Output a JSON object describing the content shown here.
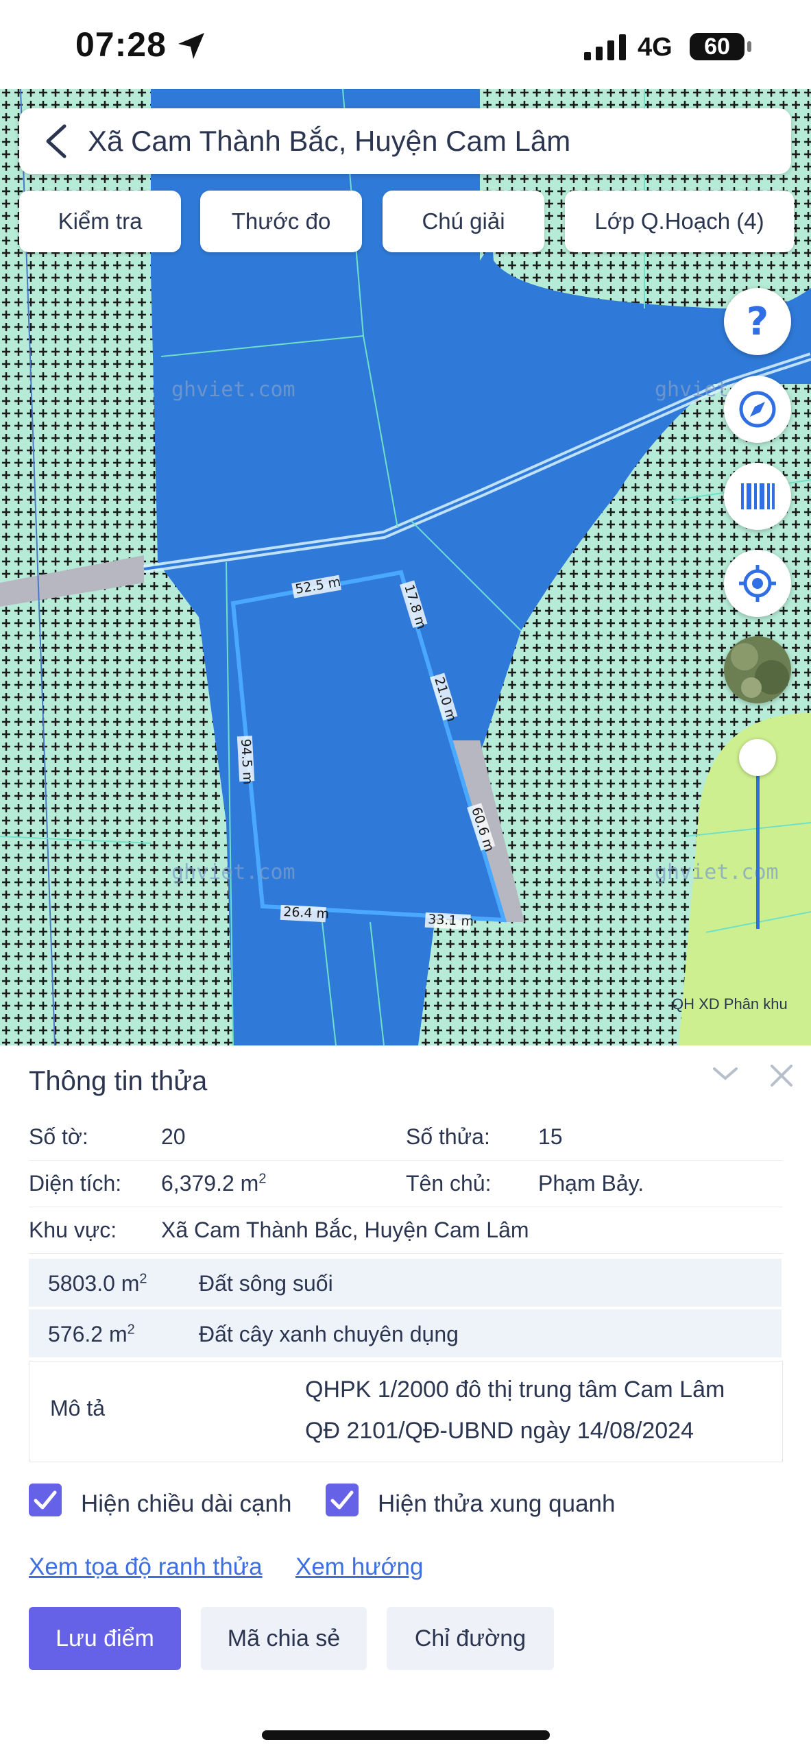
{
  "status_bar": {
    "time": "07:28",
    "network": "4G",
    "battery": "60"
  },
  "map": {
    "location": "Xã Cam Thành Bắc, Huyện Cam Lâm",
    "tabs": [
      {
        "label": "Kiểm tra"
      },
      {
        "label": "Thước đo"
      },
      {
        "label": "Chú giải"
      },
      {
        "label": "Lớp Q.Hoạch (4)"
      }
    ],
    "watermark": "ghviet.com",
    "edge_labels": [
      "52.5 m",
      "17.8 m",
      "21.0 m",
      "94.5 m",
      "60.6 m",
      "26.4 m",
      "33.1 m"
    ],
    "layer_label": "QH XD Phân khu",
    "icons": [
      "help-icon",
      "compass-icon",
      "barcode-icon",
      "locate-icon",
      "satellite-icon"
    ]
  },
  "panel": {
    "title": "Thông tin thửa",
    "to_label": "Số tờ:",
    "to_value": "20",
    "thua_label": "Số thửa:",
    "thua_value": "15",
    "area_label": "Diện tích:",
    "area_value": "6,379.2 m",
    "area_unit_sup": "2",
    "owner_label": "Tên chủ:",
    "owner_value": "Phạm Bảy.",
    "region_label": "Khu vực:",
    "region_value": "Xã Cam Thành Bắc, Huyện Cam Lâm",
    "land_uses": [
      {
        "area": "5803.0 m",
        "sup": "2",
        "type": "Đất sông suối"
      },
      {
        "area": "576.2 m",
        "sup": "2",
        "type": "Đất cây xanh chuyên dụng"
      }
    ],
    "desc_label": "Mô tả",
    "desc_line1": "QHPK 1/2000 đô thị trung tâm Cam Lâm",
    "desc_line2": "QĐ 2101/QĐ-UBND ngày 14/08/2024",
    "checkbox1": "Hiện chiều dài cạnh",
    "checkbox2": "Hiện thửa xung quanh",
    "link1": "Xem tọa độ ranh thửa",
    "link2": "Xem hướng",
    "btn_save": "Lưu điểm",
    "btn_share": "Mã chia sẻ",
    "btn_direction": "Chỉ đường"
  }
}
